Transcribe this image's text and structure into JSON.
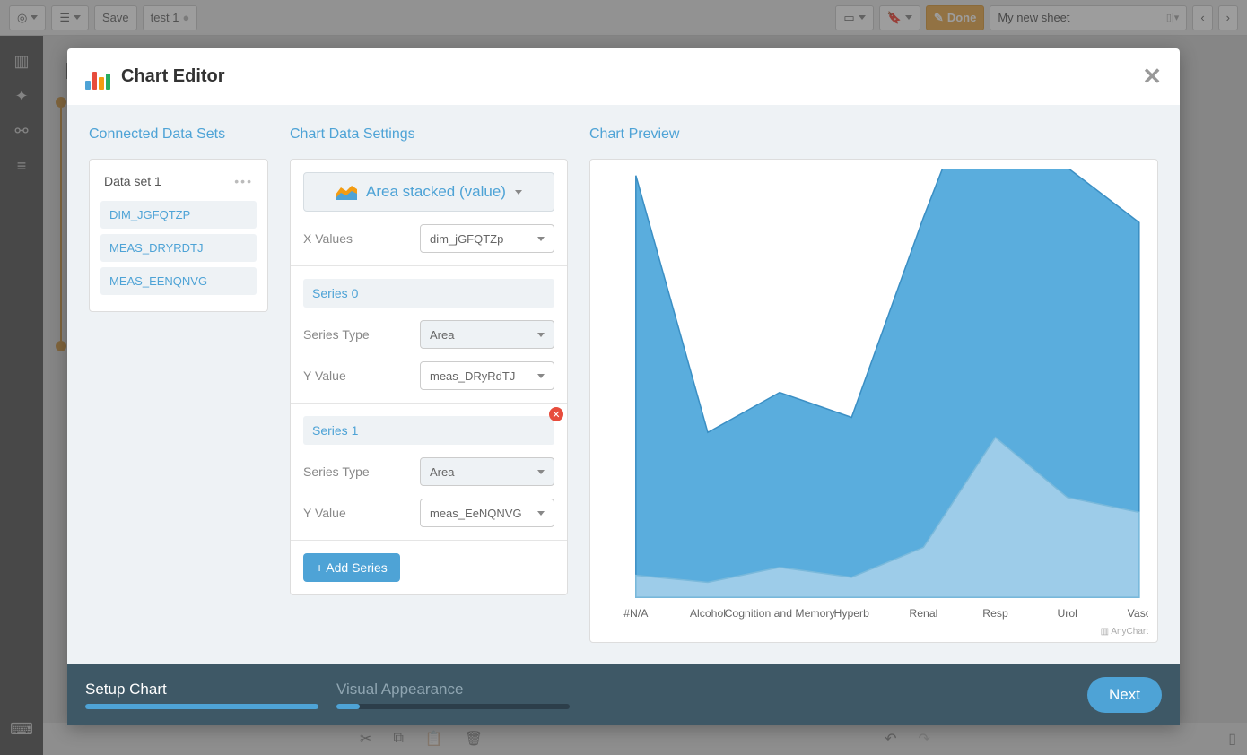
{
  "toolbar": {
    "save": "Save",
    "doc_name": "test 1",
    "done": "Done",
    "sheet_name": "My new sheet"
  },
  "bg": {
    "title": "My"
  },
  "modal": {
    "title": "Chart Editor",
    "connected_title": "Connected Data Sets",
    "settings_title": "Chart Data Settings",
    "preview_title": "Chart Preview",
    "dataset": {
      "name": "Data set 1",
      "fields": [
        "DIM_JGFQTZP",
        "MEAS_DRYRDTJ",
        "MEAS_EENQNVG"
      ]
    },
    "chart_type": "Area stacked (value)",
    "x_label": "X Values",
    "x_value": "dim_jGFQTZp",
    "series": [
      {
        "name": "Series 0",
        "type_label": "Series Type",
        "type": "Area",
        "y_label": "Y Value",
        "y": "meas_DRyRdTJ",
        "removable": false
      },
      {
        "name": "Series 1",
        "type_label": "Series Type",
        "type": "Area",
        "y_label": "Y Value",
        "y": "meas_EeNQNVG",
        "removable": true
      }
    ],
    "add_series": "+ Add Series",
    "credits": "AnyChart",
    "footer": {
      "step1": "Setup Chart",
      "step2": "Visual Appearance",
      "next": "Next"
    }
  },
  "chart_data": {
    "type": "area",
    "categories": [
      "#N/A",
      "Alcohol",
      "Cognition and Memory",
      "Hyperb",
      "Renal",
      "Resp",
      "Urol",
      "Vasc"
    ],
    "series": [
      {
        "name": "Series 0",
        "values": [
          400,
          150,
          175,
          160,
          330,
          405,
          330,
          290
        ]
      },
      {
        "name": "Series 1",
        "values": [
          22,
          15,
          30,
          20,
          50,
          160,
          100,
          85
        ]
      }
    ],
    "ylim": [
      0,
      420
    ]
  }
}
